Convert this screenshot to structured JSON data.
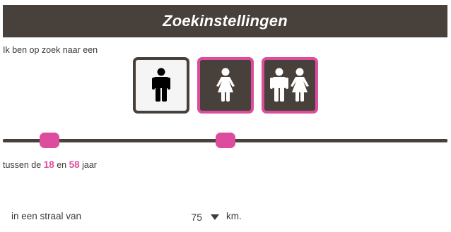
{
  "header": {
    "title": "Zoekinstellingen"
  },
  "search": {
    "intro": "Ik ben op zoek naar een",
    "options": [
      {
        "icon": "man-icon",
        "selected": false
      },
      {
        "icon": "woman-icon",
        "selected": true
      },
      {
        "icon": "couple-icon",
        "selected": true
      }
    ]
  },
  "age": {
    "prefix": "tussen de",
    "min": "18",
    "middle": "en",
    "max": "58",
    "suffix": "jaar"
  },
  "radius": {
    "label": "in een straal van",
    "value": "75",
    "unit": "km."
  },
  "colors": {
    "accent": "#de4d9d",
    "dark": "#48403a"
  }
}
